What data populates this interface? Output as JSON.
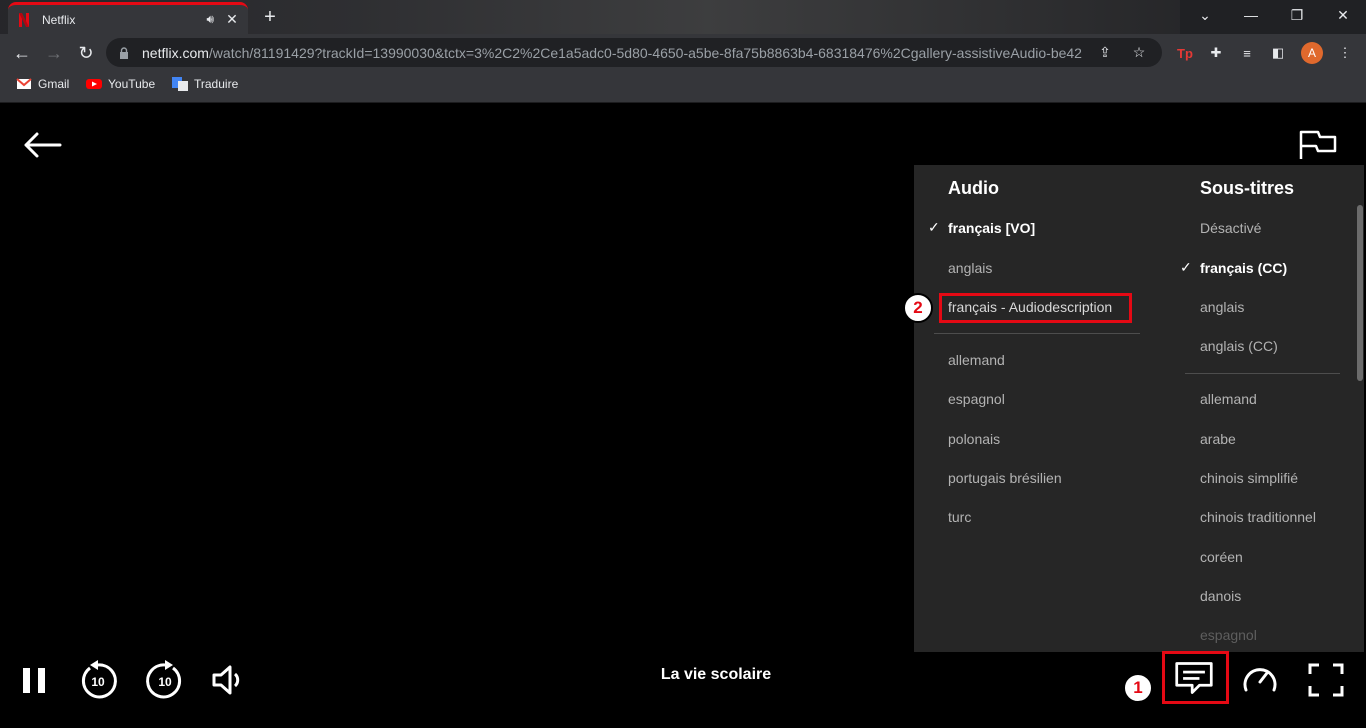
{
  "browser": {
    "tab": {
      "title": "Netflix",
      "audio_icon": "speaker-icon",
      "close": "✕"
    },
    "new_tab": "+",
    "window_controls": [
      "⌄",
      "—",
      "❐",
      "✕"
    ],
    "url_host": "netflix.com",
    "url_rest": "/watch/81191429?trackId=13990030&tctx=3%2C2%2Ce1a5adc0-5d80-4650-a5be-8fa75b8863b4-68318476%2Cgallery-assistiveAudio-be42c...",
    "avatar_letter": "A",
    "bookmarks": [
      {
        "label": "Gmail",
        "icon": "gmail-icon"
      },
      {
        "label": "YouTube",
        "icon": "youtube-icon"
      },
      {
        "label": "Traduire",
        "icon": "translate-icon"
      }
    ]
  },
  "player": {
    "episode_title": "La vie scolaire",
    "audio": {
      "header": "Audio",
      "options": [
        {
          "label": "français [VO]",
          "selected": true
        },
        {
          "label": "anglais",
          "selected": false
        },
        {
          "label": "français - Audiodescription",
          "selected": false
        }
      ],
      "more_options": [
        "allemand",
        "espagnol",
        "polonais",
        "portugais brésilien",
        "turc"
      ]
    },
    "subtitles": {
      "header": "Sous-titres",
      "options": [
        {
          "label": "Désactivé",
          "selected": false
        },
        {
          "label": "français (CC)",
          "selected": true
        },
        {
          "label": "anglais",
          "selected": false
        },
        {
          "label": "anglais (CC)",
          "selected": false
        }
      ],
      "more_options": [
        "allemand",
        "arabe",
        "chinois simplifié",
        "chinois traditionnel",
        "coréen",
        "danois",
        "espagnol"
      ]
    },
    "callouts": {
      "one": "1",
      "two": "2"
    },
    "check_mark": "✓"
  },
  "colors": {
    "accent": "#e50914",
    "panel_bg": "#262626",
    "muted_text": "#b3b3b3"
  }
}
